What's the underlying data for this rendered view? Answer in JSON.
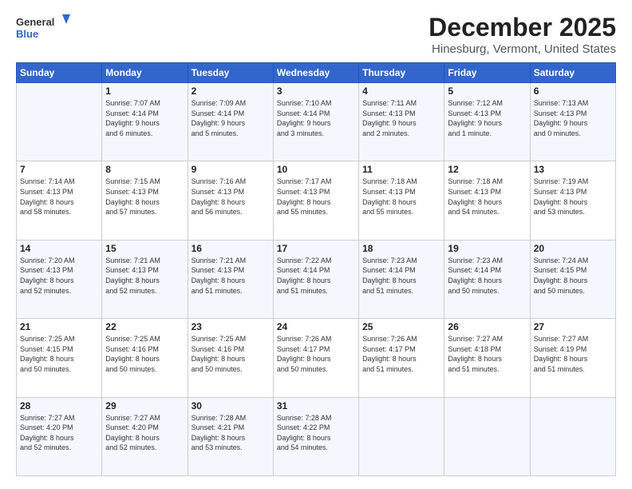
{
  "header": {
    "logo": {
      "line1": "General",
      "line2": "Blue"
    },
    "title": "December 2025",
    "subtitle": "Hinesburg, Vermont, United States"
  },
  "calendar": {
    "weekdays": [
      "Sunday",
      "Monday",
      "Tuesday",
      "Wednesday",
      "Thursday",
      "Friday",
      "Saturday"
    ],
    "weeks": [
      [
        {
          "day": "",
          "info": ""
        },
        {
          "day": "1",
          "info": "Sunrise: 7:07 AM\nSunset: 4:14 PM\nDaylight: 9 hours\nand 6 minutes."
        },
        {
          "day": "2",
          "info": "Sunrise: 7:09 AM\nSunset: 4:14 PM\nDaylight: 9 hours\nand 5 minutes."
        },
        {
          "day": "3",
          "info": "Sunrise: 7:10 AM\nSunset: 4:14 PM\nDaylight: 9 hours\nand 3 minutes."
        },
        {
          "day": "4",
          "info": "Sunrise: 7:11 AM\nSunset: 4:13 PM\nDaylight: 9 hours\nand 2 minutes."
        },
        {
          "day": "5",
          "info": "Sunrise: 7:12 AM\nSunset: 4:13 PM\nDaylight: 9 hours\nand 1 minute."
        },
        {
          "day": "6",
          "info": "Sunrise: 7:13 AM\nSunset: 4:13 PM\nDaylight: 9 hours\nand 0 minutes."
        }
      ],
      [
        {
          "day": "7",
          "info": "Sunrise: 7:14 AM\nSunset: 4:13 PM\nDaylight: 8 hours\nand 58 minutes."
        },
        {
          "day": "8",
          "info": "Sunrise: 7:15 AM\nSunset: 4:13 PM\nDaylight: 8 hours\nand 57 minutes."
        },
        {
          "day": "9",
          "info": "Sunrise: 7:16 AM\nSunset: 4:13 PM\nDaylight: 8 hours\nand 56 minutes."
        },
        {
          "day": "10",
          "info": "Sunrise: 7:17 AM\nSunset: 4:13 PM\nDaylight: 8 hours\nand 55 minutes."
        },
        {
          "day": "11",
          "info": "Sunrise: 7:18 AM\nSunset: 4:13 PM\nDaylight: 8 hours\nand 55 minutes."
        },
        {
          "day": "12",
          "info": "Sunrise: 7:18 AM\nSunset: 4:13 PM\nDaylight: 8 hours\nand 54 minutes."
        },
        {
          "day": "13",
          "info": "Sunrise: 7:19 AM\nSunset: 4:13 PM\nDaylight: 8 hours\nand 53 minutes."
        }
      ],
      [
        {
          "day": "14",
          "info": "Sunrise: 7:20 AM\nSunset: 4:13 PM\nDaylight: 8 hours\nand 52 minutes."
        },
        {
          "day": "15",
          "info": "Sunrise: 7:21 AM\nSunset: 4:13 PM\nDaylight: 8 hours\nand 52 minutes."
        },
        {
          "day": "16",
          "info": "Sunrise: 7:21 AM\nSunset: 4:13 PM\nDaylight: 8 hours\nand 51 minutes."
        },
        {
          "day": "17",
          "info": "Sunrise: 7:22 AM\nSunset: 4:14 PM\nDaylight: 8 hours\nand 51 minutes."
        },
        {
          "day": "18",
          "info": "Sunrise: 7:23 AM\nSunset: 4:14 PM\nDaylight: 8 hours\nand 51 minutes."
        },
        {
          "day": "19",
          "info": "Sunrise: 7:23 AM\nSunset: 4:14 PM\nDaylight: 8 hours\nand 50 minutes."
        },
        {
          "day": "20",
          "info": "Sunrise: 7:24 AM\nSunset: 4:15 PM\nDaylight: 8 hours\nand 50 minutes."
        }
      ],
      [
        {
          "day": "21",
          "info": "Sunrise: 7:25 AM\nSunset: 4:15 PM\nDaylight: 8 hours\nand 50 minutes."
        },
        {
          "day": "22",
          "info": "Sunrise: 7:25 AM\nSunset: 4:16 PM\nDaylight: 8 hours\nand 50 minutes."
        },
        {
          "day": "23",
          "info": "Sunrise: 7:25 AM\nSunset: 4:16 PM\nDaylight: 8 hours\nand 50 minutes."
        },
        {
          "day": "24",
          "info": "Sunrise: 7:26 AM\nSunset: 4:17 PM\nDaylight: 8 hours\nand 50 minutes."
        },
        {
          "day": "25",
          "info": "Sunrise: 7:26 AM\nSunset: 4:17 PM\nDaylight: 8 hours\nand 51 minutes."
        },
        {
          "day": "26",
          "info": "Sunrise: 7:27 AM\nSunset: 4:18 PM\nDaylight: 8 hours\nand 51 minutes."
        },
        {
          "day": "27",
          "info": "Sunrise: 7:27 AM\nSunset: 4:19 PM\nDaylight: 8 hours\nand 51 minutes."
        }
      ],
      [
        {
          "day": "28",
          "info": "Sunrise: 7:27 AM\nSunset: 4:20 PM\nDaylight: 8 hours\nand 52 minutes."
        },
        {
          "day": "29",
          "info": "Sunrise: 7:27 AM\nSunset: 4:20 PM\nDaylight: 8 hours\nand 52 minutes."
        },
        {
          "day": "30",
          "info": "Sunrise: 7:28 AM\nSunset: 4:21 PM\nDaylight: 8 hours\nand 53 minutes."
        },
        {
          "day": "31",
          "info": "Sunrise: 7:28 AM\nSunset: 4:22 PM\nDaylight: 8 hours\nand 54 minutes."
        },
        {
          "day": "",
          "info": ""
        },
        {
          "day": "",
          "info": ""
        },
        {
          "day": "",
          "info": ""
        }
      ]
    ]
  }
}
